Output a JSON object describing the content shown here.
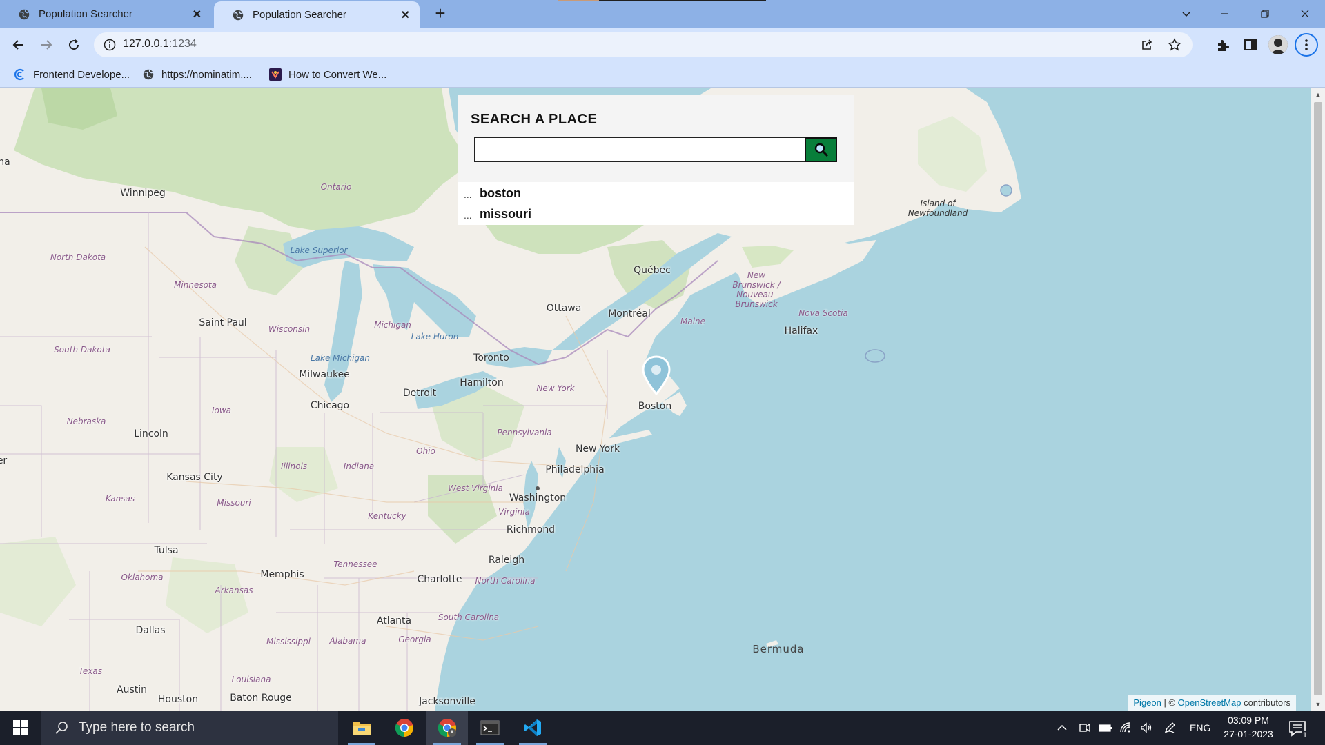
{
  "browser": {
    "tabs": [
      {
        "title": "Population Searcher",
        "active": false
      },
      {
        "title": "Population Searcher",
        "active": true
      }
    ],
    "url_host": "127.0.0.1",
    "url_port": ":1234",
    "bookmarks": [
      {
        "label": "Frontend Develope...",
        "icon": "frontend-icon"
      },
      {
        "label": "https://nominatim....",
        "icon": "globe-icon"
      },
      {
        "label": "How to Convert We...",
        "icon": "site-icon"
      }
    ]
  },
  "search": {
    "title": "SEARCH A PLACE",
    "input_value": "",
    "button_icon": "search-icon",
    "history": [
      "boston",
      "missouri"
    ],
    "history_marker": "..."
  },
  "map": {
    "marker_label": "Boston",
    "cities": [
      "Winnipeg",
      "Saint Paul",
      "Milwaukee",
      "Chicago",
      "Detroit",
      "Toronto",
      "Hamilton",
      "Ottawa",
      "Montréal",
      "Québec",
      "Halifax",
      "Boston",
      "New York",
      "Philadelphia",
      "Washington",
      "Richmond",
      "Raleigh",
      "Charlotte",
      "Atlanta",
      "Memphis",
      "Tulsa",
      "Dallas",
      "Austin",
      "Houston",
      "Baton Rouge",
      "Jacksonville",
      "Kansas City",
      "Lincoln"
    ],
    "regions": [
      "Ontario",
      "North Dakota",
      "Minnesota",
      "South Dakota",
      "Wisconsin",
      "Michigan",
      "Iowa",
      "Nebraska",
      "Illinois",
      "Indiana",
      "Ohio",
      "Pennsylvania",
      "New York",
      "Maine",
      "Nova Scotia",
      "West Virginia",
      "Virginia",
      "Kentucky",
      "Kansas",
      "Missouri",
      "Tennessee",
      "North Carolina",
      "South Carolina",
      "Georgia",
      "Alabama",
      "Mississippi",
      "Arkansas",
      "Oklahoma",
      "Texas",
      "Louisiana"
    ],
    "water": [
      "Lake Superior",
      "Lake Michigan",
      "Lake Huron"
    ],
    "special": [
      "Island of Newfoundland",
      "New Brunswick / Nouveau-Brunswick",
      "Bermuda"
    ],
    "edge_labels": [
      "na",
      "er"
    ],
    "attribution": {
      "leaflet": "Pigeon",
      "sep": " | © ",
      "osm": "OpenStreetMap",
      "rest": " contributors"
    }
  },
  "taskbar": {
    "search_placeholder": "Type here to search",
    "apps": [
      "file-explorer-icon",
      "chrome-icon",
      "chrome-profile-icon",
      "terminal-icon",
      "vscode-icon"
    ],
    "language": "ENG",
    "time": "03:09 PM",
    "date": "27-01-2023",
    "notification_count": "1"
  },
  "colors": {
    "search_button": "#087e3a",
    "marker": "#8fc3d9",
    "water": "#aad3df",
    "land": "#f2efe9",
    "forest": "#c8dfb4"
  }
}
